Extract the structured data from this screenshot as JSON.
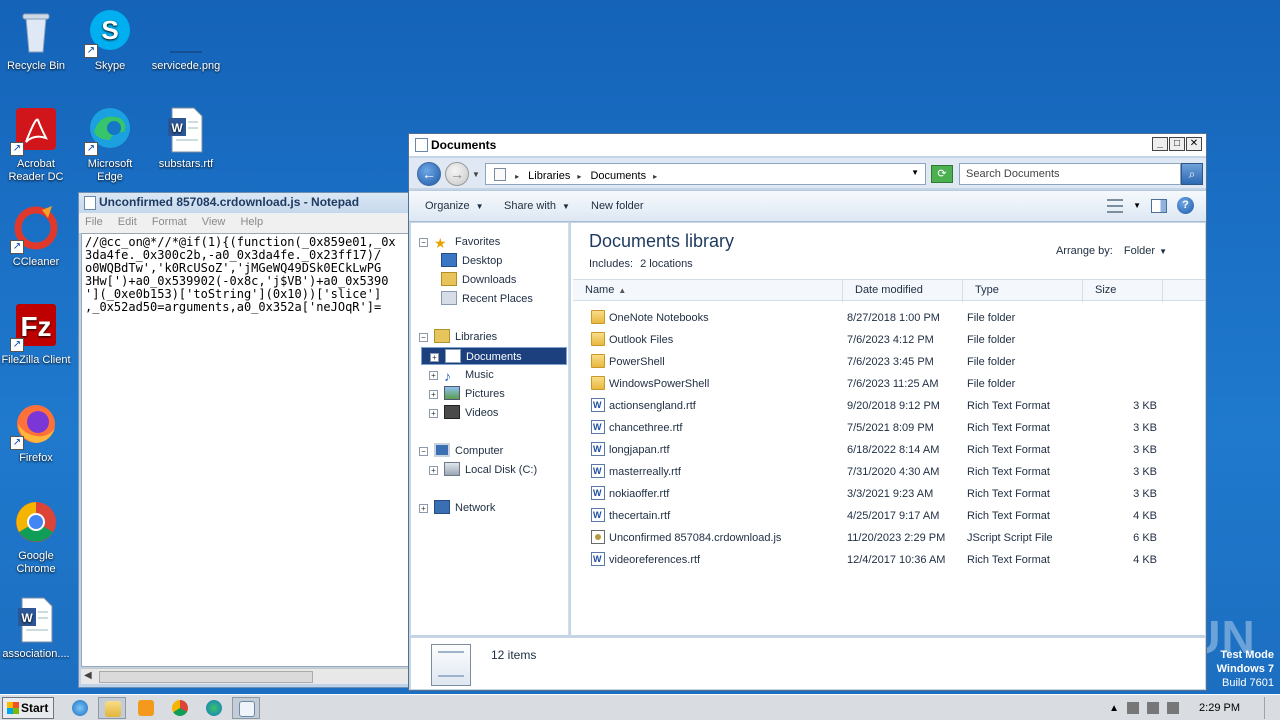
{
  "desktop": {
    "icons": {
      "recycle_bin": "Recycle Bin",
      "skype": "Skype",
      "servicede": "servicede.png",
      "acrobat": "Acrobat Reader DC",
      "edge": "Microsoft Edge",
      "substars": "substars.rtf",
      "ccleaner": "CCleaner",
      "filezilla": "FileZilla Client",
      "firefox": "Firefox",
      "chrome": "Google Chrome",
      "association": "association...."
    },
    "watermark": "ANY RUN",
    "test_mode": {
      "line1": "Test Mode",
      "line2": "Windows 7",
      "line3": "Build 7601"
    }
  },
  "notepad": {
    "title": "Unconfirmed 857084.crdownload.js - Notepad",
    "menu": [
      "File",
      "Edit",
      "Format",
      "View",
      "Help"
    ],
    "content": "//@cc_on@*//*@if(1){(function(_0x859e01,_0x\n3da4fe._0x300c2b,-a0_0x3da4fe._0x23ff17)/\no0WQBdTw','k0RcUSoZ','jMGeWQ49DSk0ECkLwPG\n3Hw[')+a0_0x539902(-0x8c,'j$VB')+a0_0x5390\n'](_0xe0b153)['toString'](0x10))['slice']\n,_0x52ad50=arguments,a0_0x352a['neJOqR']="
  },
  "explorer": {
    "title": "Documents",
    "breadcrumb": [
      "Libraries",
      "Documents"
    ],
    "search_placeholder": "Search Documents",
    "toolbar": {
      "organize": "Organize",
      "share_with": "Share with",
      "new_folder": "New folder"
    },
    "nav": {
      "favorites": "Favorites",
      "desktop": "Desktop",
      "downloads": "Downloads",
      "recent_places": "Recent Places",
      "libraries": "Libraries",
      "documents": "Documents",
      "music": "Music",
      "pictures": "Pictures",
      "videos": "Videos",
      "computer": "Computer",
      "local_disk": "Local Disk (C:)",
      "network": "Network"
    },
    "library": {
      "title": "Documents library",
      "includes_label": "Includes:",
      "includes_value": "2 locations",
      "arrange_label": "Arrange by:",
      "arrange_value": "Folder"
    },
    "columns": {
      "name": "Name",
      "date": "Date modified",
      "type": "Type",
      "size": "Size"
    },
    "files": [
      {
        "name": "OneNote Notebooks",
        "date": "8/27/2018 1:00 PM",
        "type": "File folder",
        "size": "",
        "icon": "folder"
      },
      {
        "name": "Outlook Files",
        "date": "7/6/2023 4:12 PM",
        "type": "File folder",
        "size": "",
        "icon": "folder"
      },
      {
        "name": "PowerShell",
        "date": "7/6/2023 3:45 PM",
        "type": "File folder",
        "size": "",
        "icon": "folder"
      },
      {
        "name": "WindowsPowerShell",
        "date": "7/6/2023 11:25 AM",
        "type": "File folder",
        "size": "",
        "icon": "folder"
      },
      {
        "name": "actionsengland.rtf",
        "date": "9/20/2018 9:12 PM",
        "type": "Rich Text Format",
        "size": "3 KB",
        "icon": "rtf"
      },
      {
        "name": "chancethree.rtf",
        "date": "7/5/2021 8:09 PM",
        "type": "Rich Text Format",
        "size": "3 KB",
        "icon": "rtf"
      },
      {
        "name": "longjapan.rtf",
        "date": "6/18/2022 8:14 AM",
        "type": "Rich Text Format",
        "size": "3 KB",
        "icon": "rtf"
      },
      {
        "name": "masterreally.rtf",
        "date": "7/31/2020 4:30 AM",
        "type": "Rich Text Format",
        "size": "3 KB",
        "icon": "rtf"
      },
      {
        "name": "nokiaoffer.rtf",
        "date": "3/3/2021 9:23 AM",
        "type": "Rich Text Format",
        "size": "3 KB",
        "icon": "rtf"
      },
      {
        "name": "thecertain.rtf",
        "date": "4/25/2017 9:17 AM",
        "type": "Rich Text Format",
        "size": "4 KB",
        "icon": "rtf"
      },
      {
        "name": "Unconfirmed 857084.crdownload.js",
        "date": "11/20/2023 2:29 PM",
        "type": "JScript Script File",
        "size": "6 KB",
        "icon": "js"
      },
      {
        "name": "videoreferences.rtf",
        "date": "12/4/2017 10:36 AM",
        "type": "Rich Text Format",
        "size": "4 KB",
        "icon": "rtf"
      }
    ],
    "item_count": "12 items"
  },
  "taskbar": {
    "start": "Start",
    "clock": "2:29 PM"
  }
}
